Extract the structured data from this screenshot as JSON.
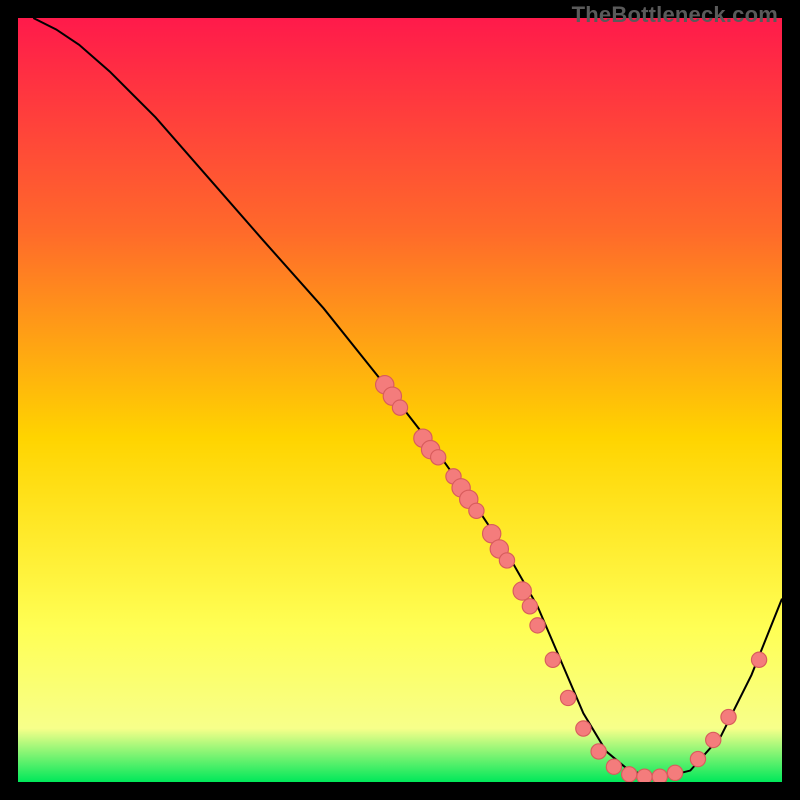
{
  "watermark": "TheBottleneck.com",
  "colors": {
    "gradient_top": "#ff1a4b",
    "gradient_upper_mid": "#ff6a2a",
    "gradient_mid": "#ffd400",
    "gradient_lower_mid": "#ffff55",
    "gradient_near_bottom": "#f7ff8a",
    "gradient_bottom": "#00e85a",
    "curve": "#000000",
    "marker_fill": "#f47c7c",
    "marker_stroke": "#d85c5c",
    "frame_bg": "#000000"
  },
  "chart_data": {
    "type": "line",
    "title": "",
    "xlabel": "",
    "ylabel": "",
    "xlim": [
      0,
      100
    ],
    "ylim": [
      0,
      100
    ],
    "grid": false,
    "legend": false,
    "series": [
      {
        "name": "curve",
        "x": [
          2,
          5,
          8,
          12,
          18,
          25,
          32,
          40,
          48,
          55,
          60,
          64,
          68,
          71,
          74,
          77,
          80,
          84,
          88,
          92,
          96,
          100
        ],
        "values": [
          100,
          98.5,
          96.5,
          93,
          87,
          79,
          71,
          62,
          52,
          43,
          36,
          30,
          23,
          16,
          9,
          4,
          1.5,
          0.5,
          1.5,
          6,
          14,
          24
        ]
      }
    ],
    "markers": [
      {
        "x": 48,
        "y": 52,
        "r": 1.2
      },
      {
        "x": 49,
        "y": 50.5,
        "r": 1.2
      },
      {
        "x": 50,
        "y": 49,
        "r": 1.0
      },
      {
        "x": 53,
        "y": 45,
        "r": 1.2
      },
      {
        "x": 54,
        "y": 43.5,
        "r": 1.2
      },
      {
        "x": 55,
        "y": 42.5,
        "r": 1.0
      },
      {
        "x": 57,
        "y": 40,
        "r": 1.0
      },
      {
        "x": 58,
        "y": 38.5,
        "r": 1.2
      },
      {
        "x": 59,
        "y": 37,
        "r": 1.2
      },
      {
        "x": 60,
        "y": 35.5,
        "r": 1.0
      },
      {
        "x": 62,
        "y": 32.5,
        "r": 1.2
      },
      {
        "x": 63,
        "y": 30.5,
        "r": 1.2
      },
      {
        "x": 64,
        "y": 29,
        "r": 1.0
      },
      {
        "x": 66,
        "y": 25,
        "r": 1.2
      },
      {
        "x": 67,
        "y": 23,
        "r": 1.0
      },
      {
        "x": 68,
        "y": 20.5,
        "r": 1.0
      },
      {
        "x": 70,
        "y": 16,
        "r": 1.0
      },
      {
        "x": 72,
        "y": 11,
        "r": 1.0
      },
      {
        "x": 74,
        "y": 7,
        "r": 1.0
      },
      {
        "x": 76,
        "y": 4,
        "r": 1.0
      },
      {
        "x": 78,
        "y": 2,
        "r": 1.0
      },
      {
        "x": 80,
        "y": 1,
        "r": 1.0
      },
      {
        "x": 82,
        "y": 0.7,
        "r": 1.0
      },
      {
        "x": 84,
        "y": 0.7,
        "r": 1.0
      },
      {
        "x": 86,
        "y": 1.2,
        "r": 1.0
      },
      {
        "x": 89,
        "y": 3,
        "r": 1.0
      },
      {
        "x": 91,
        "y": 5.5,
        "r": 1.0
      },
      {
        "x": 93,
        "y": 8.5,
        "r": 1.0
      },
      {
        "x": 97,
        "y": 16,
        "r": 1.0
      }
    ]
  }
}
